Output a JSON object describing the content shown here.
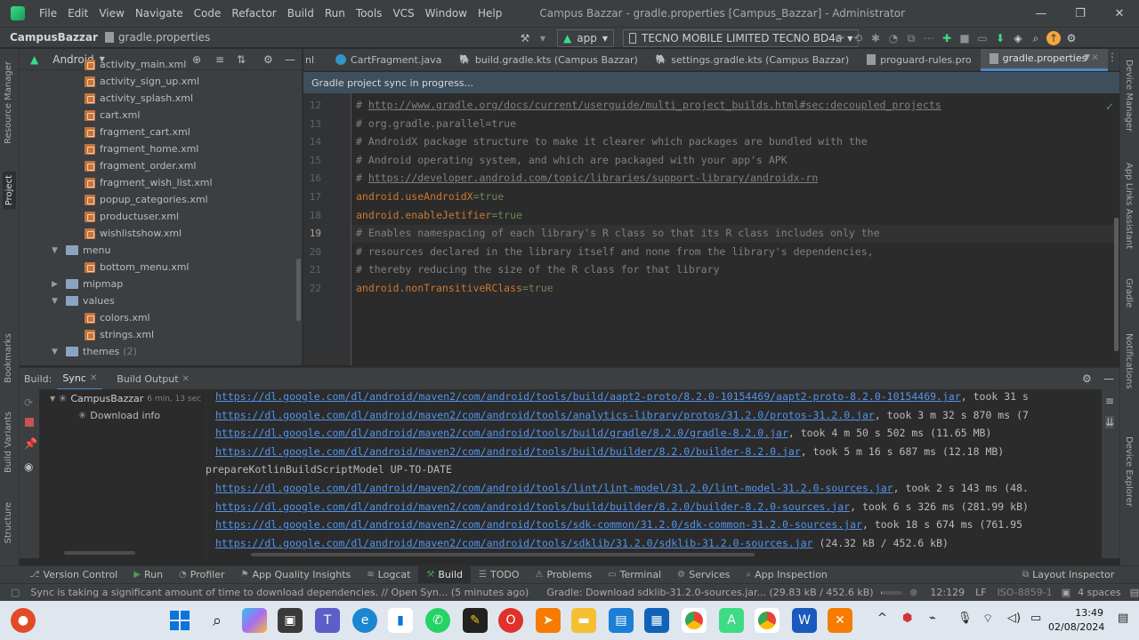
{
  "menu": [
    "File",
    "Edit",
    "View",
    "Navigate",
    "Code",
    "Refactor",
    "Build",
    "Run",
    "Tools",
    "VCS",
    "Window",
    "Help"
  ],
  "window_title": "Campus Bazzar - gradle.properties [Campus_Bazzar] - Administrator",
  "window_controls": {
    "minimize": "—",
    "restore": "❐",
    "close": "✕"
  },
  "breadcrumb": {
    "project": "CampusBazzar",
    "file": "gradle.properties"
  },
  "toolbar": {
    "run_config": "app",
    "device": "TECNO MOBILE LIMITED TECNO BD4a"
  },
  "project_panel": {
    "view": "Android",
    "items": [
      {
        "label": "activity_main.xml",
        "type": "file"
      },
      {
        "label": "activity_sign_up.xml",
        "type": "file"
      },
      {
        "label": "activity_splash.xml",
        "type": "file"
      },
      {
        "label": "cart.xml",
        "type": "file"
      },
      {
        "label": "fragment_cart.xml",
        "type": "file"
      },
      {
        "label": "fragment_home.xml",
        "type": "file"
      },
      {
        "label": "fragment_order.xml",
        "type": "file"
      },
      {
        "label": "fragment_wish_list.xml",
        "type": "file"
      },
      {
        "label": "popup_categories.xml",
        "type": "file"
      },
      {
        "label": "productuser.xml",
        "type": "file"
      },
      {
        "label": "wishlistshow.xml",
        "type": "file"
      },
      {
        "label": "menu",
        "type": "folder-open"
      },
      {
        "label": "bottom_menu.xml",
        "type": "file"
      },
      {
        "label": "mipmap",
        "type": "folder-closed"
      },
      {
        "label": "values",
        "type": "folder-open"
      },
      {
        "label": "colors.xml",
        "type": "file"
      },
      {
        "label": "strings.xml",
        "type": "file"
      },
      {
        "label": "themes",
        "type": "folder-open",
        "count": "(2)"
      }
    ]
  },
  "editor_tabs": [
    {
      "label": "nl",
      "icon": "none"
    },
    {
      "label": "CartFragment.java",
      "icon": "class-icon"
    },
    {
      "label": "build.gradle.kts (Campus Bazzar)",
      "icon": "gradle-icon"
    },
    {
      "label": "settings.gradle.kts (Campus Bazzar)",
      "icon": "gradle-icon"
    },
    {
      "label": "proguard-rules.pro",
      "icon": "file-icon"
    },
    {
      "label": "gradle.properties",
      "icon": "file-icon",
      "active": true
    }
  ],
  "sync_banner": "Gradle project sync in progress...",
  "code_lines": [
    {
      "num": "12",
      "parts": [
        {
          "t": "# ",
          "c": "cm"
        },
        {
          "t": "http://www.gradle.org/docs/current/userguide/multi_project_builds.html#sec:decoupled_projects",
          "c": "link"
        }
      ]
    },
    {
      "num": "13",
      "parts": [
        {
          "t": "# org.gradle.parallel=true",
          "c": "cm"
        }
      ]
    },
    {
      "num": "14",
      "parts": [
        {
          "t": "# AndroidX package structure to make it clearer which packages are bundled with the",
          "c": "cm"
        }
      ]
    },
    {
      "num": "15",
      "parts": [
        {
          "t": "# Android operating system, and which are packaged with your app's APK",
          "c": "cm"
        }
      ]
    },
    {
      "num": "16",
      "parts": [
        {
          "t": "# ",
          "c": "cm"
        },
        {
          "t": "https://developer.android.com/topic/libraries/support-library/androidx-rn",
          "c": "link"
        }
      ]
    },
    {
      "num": "17",
      "parts": [
        {
          "t": "android.useAndroidX",
          "c": "key"
        },
        {
          "t": "=true",
          "c": "val"
        }
      ]
    },
    {
      "num": "18",
      "parts": [
        {
          "t": "android.enableJetifier",
          "c": "key"
        },
        {
          "t": "=true",
          "c": "val"
        }
      ]
    },
    {
      "num": "19",
      "parts": [
        {
          "t": "# Enables namespacing of each library's R class so that its R class includes only the",
          "c": "cm"
        }
      ]
    },
    {
      "num": "20",
      "parts": [
        {
          "t": "# resources declared in the library itself and none from the library's dependencies,",
          "c": "cm"
        }
      ]
    },
    {
      "num": "21",
      "parts": [
        {
          "t": "# thereby reducing the size of the R class for that library",
          "c": "cm"
        }
      ]
    },
    {
      "num": "22",
      "parts": [
        {
          "t": "android.nonTransitiveRClass",
          "c": "key"
        },
        {
          "t": "=true",
          "c": "val"
        }
      ]
    }
  ],
  "build_panel": {
    "label": "Build:",
    "tabs": [
      "Sync",
      "Build Output"
    ],
    "tree": {
      "root": "CampusBazzar",
      "root_time": "6 min, 13 sec",
      "child": "Download info"
    },
    "output": [
      {
        "link": "https://dl.google.com/dl/android/maven2/com/android/tools/build/aapt2-proto/8.2.0-10154469/aapt2-proto-8.2.0-10154469.jar",
        "text": ", took 31 s"
      },
      {
        "link": "https://dl.google.com/dl/android/maven2/com/android/tools/analytics-library/protos/31.2.0/protos-31.2.0.jar",
        "text": ", took 3 m 32 s 870 ms (7"
      },
      {
        "link": "https://dl.google.com/dl/android/maven2/com/android/tools/build/gradle/8.2.0/gradle-8.2.0.jar",
        "text": ", took 4 m 50 s 502 ms (11.65 MB)"
      },
      {
        "link": "https://dl.google.com/dl/android/maven2/com/android/tools/build/builder/8.2.0/builder-8.2.0.jar",
        "text": ", took 5 m 16 s 687 ms (12.18 MB)"
      },
      {
        "link": "",
        "text": "prepareKotlinBuildScriptModel UP-TO-DATE"
      },
      {
        "link": "https://dl.google.com/dl/android/maven2/com/android/tools/lint/lint-model/31.2.0/lint-model-31.2.0-sources.jar",
        "text": ", took 2 s 143 ms (48."
      },
      {
        "link": "https://dl.google.com/dl/android/maven2/com/android/tools/build/builder/8.2.0/builder-8.2.0-sources.jar",
        "text": ", took 6 s 326 ms (281.99 kB)"
      },
      {
        "link": "https://dl.google.com/dl/android/maven2/com/android/tools/sdk-common/31.2.0/sdk-common-31.2.0-sources.jar",
        "text": ", took 18 s 674 ms (761.95"
      },
      {
        "link": "https://dl.google.com/dl/android/maven2/com/android/tools/sdklib/31.2.0/sdklib-31.2.0-sources.jar",
        "text": " (24.32 kB / 452.6 kB)"
      }
    ]
  },
  "left_strip": {
    "tabs": [
      "Resource Manager",
      "Project",
      "Bookmarks",
      "Build Variants",
      "Structure"
    ]
  },
  "right_strip": {
    "tabs": [
      "Device Manager",
      "App Links Assistant",
      "Gradle",
      "Notifications",
      "Device Explorer"
    ]
  },
  "bottom_tools": [
    "Version Control",
    "Run",
    "Profiler",
    "App Quality Insights",
    "Logcat",
    "Build",
    "TODO",
    "Problems",
    "Terminal",
    "Services",
    "App Inspection",
    "Layout Inspector"
  ],
  "status": {
    "message": "Sync is taking a significant amount of time to download dependencies. // Open Syn... (5 minutes ago)",
    "task": "Gradle: Download sdklib-31.2.0-sources.jar... (29.83 kB / 452.6 kB)",
    "progress": 0.066,
    "position": "12:129",
    "line_sep": "LF",
    "encoding": "ISO-8859-1",
    "indent": "4 spaces"
  },
  "taskbar": {
    "time": "13:49",
    "date": "02/08/2024"
  },
  "colors": {
    "accent": "#4a88c7",
    "link": "#5394ec",
    "keyword": "#cc7832",
    "string": "#6a8759",
    "comment": "#808080"
  }
}
